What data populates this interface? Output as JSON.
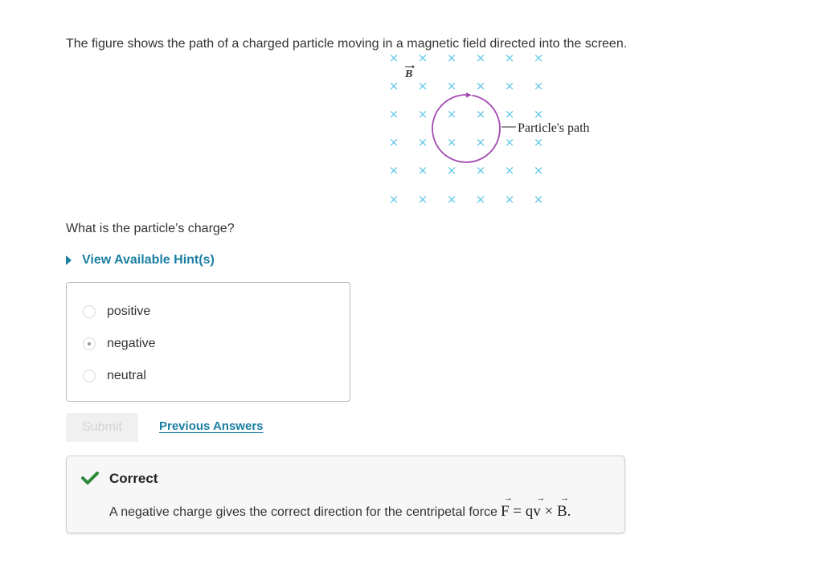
{
  "intro_text": "The figure shows the path of a charged particle moving in a magnetic field directed into the screen.",
  "figure": {
    "field_label": "B",
    "path_label": "Particle's path",
    "field_symbol": "×",
    "field_color": "#5cc6e8",
    "path_color": "#a24ab0",
    "direction": "clockwise"
  },
  "question": "What is the particle’s charge?",
  "hint_label": "View Available Hint(s)",
  "choices": [
    {
      "label": "positive",
      "selected": false
    },
    {
      "label": "negative",
      "selected": true
    },
    {
      "label": "neutral",
      "selected": false
    }
  ],
  "submit_label": "Submit",
  "previous_answers_label": "Previous Answers",
  "feedback": {
    "title": "Correct",
    "text": "A negative charge gives the correct direction for the centripetal force",
    "formula": {
      "F": "F",
      "eq": "=",
      "q": "q",
      "v": "v",
      "times": "×",
      "B": "B",
      "end": "."
    },
    "status_color": "#2e8b3d"
  },
  "colors": {
    "link": "#1a7fa3"
  }
}
